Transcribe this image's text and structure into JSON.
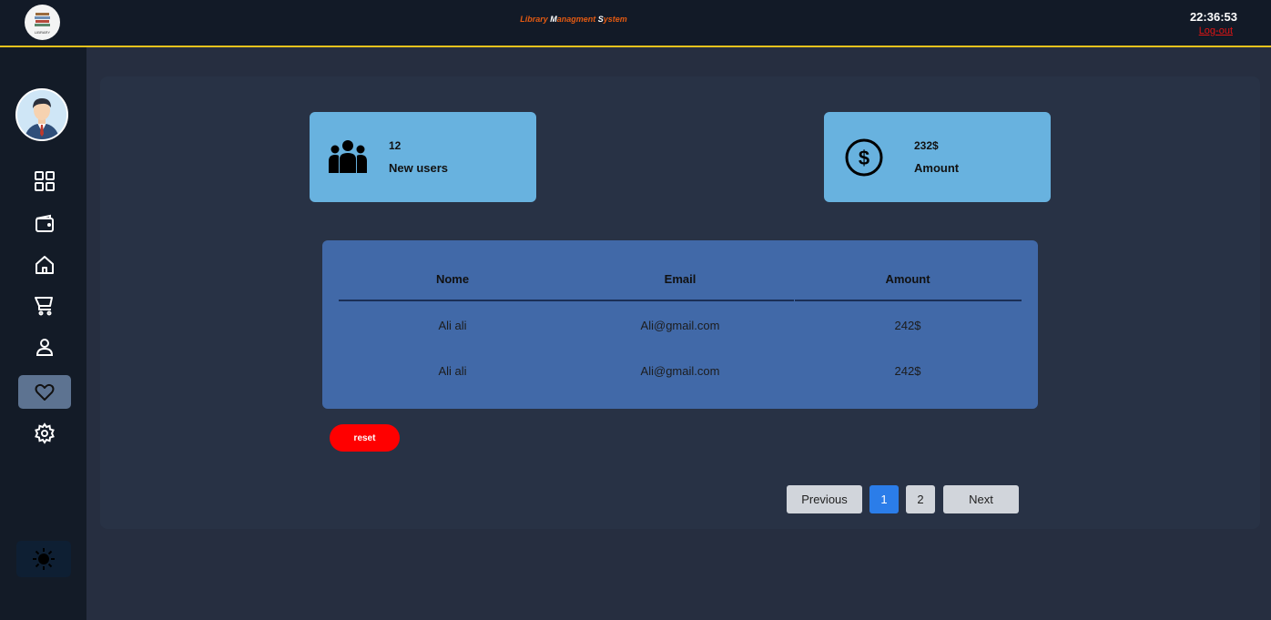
{
  "header": {
    "title_parts": [
      "Library ",
      "M",
      "anagment ",
      "S",
      "ystem"
    ],
    "time": "22:36:53",
    "logout_label": "Log-out",
    "logo_text": "LIBRARY"
  },
  "sidebar": {
    "items": [
      {
        "name": "dashboard",
        "icon": "grid-icon",
        "active": false
      },
      {
        "name": "wallet",
        "icon": "wallet-icon",
        "active": false
      },
      {
        "name": "home",
        "icon": "home-icon",
        "active": false
      },
      {
        "name": "cart",
        "icon": "cart-icon",
        "active": false
      },
      {
        "name": "user",
        "icon": "user-icon",
        "active": false
      },
      {
        "name": "favorites",
        "icon": "heart-icon",
        "active": true
      },
      {
        "name": "settings",
        "icon": "gear-icon",
        "active": false
      }
    ],
    "theme_icon": "sun-icon"
  },
  "cards": [
    {
      "value": "12",
      "label": "New users",
      "icon": "users-icon"
    },
    {
      "value": "232$",
      "label": "Amount",
      "icon": "dollar-circle-icon"
    }
  ],
  "table": {
    "headers": [
      "Nome",
      "Email",
      "Amount"
    ],
    "rows": [
      [
        "Ali ali",
        "Ali@gmail.com",
        "242$"
      ],
      [
        "Ali ali",
        "Ali@gmail.com",
        "242$"
      ]
    ]
  },
  "reset_label": "reset",
  "pagination": {
    "previous": "Previous",
    "pages": [
      "1",
      "2"
    ],
    "current": "1",
    "next": "Next"
  },
  "colors": {
    "accent_yellow": "#e8c21c",
    "title_orange": "#e35a12",
    "card_blue": "#68b2df",
    "table_blue": "#4169a8",
    "reset_red": "#ff0000",
    "page_active": "#2b7de9"
  }
}
